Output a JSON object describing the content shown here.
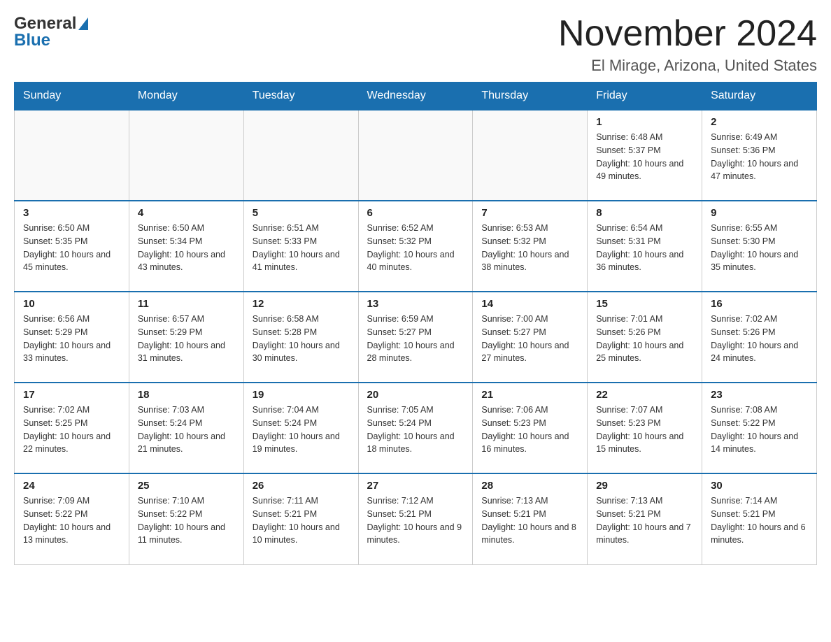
{
  "logo": {
    "line1": "General",
    "line2": "Blue"
  },
  "title": "November 2024",
  "subtitle": "El Mirage, Arizona, United States",
  "days_of_week": [
    "Sunday",
    "Monday",
    "Tuesday",
    "Wednesday",
    "Thursday",
    "Friday",
    "Saturday"
  ],
  "weeks": [
    [
      {
        "day": "",
        "info": ""
      },
      {
        "day": "",
        "info": ""
      },
      {
        "day": "",
        "info": ""
      },
      {
        "day": "",
        "info": ""
      },
      {
        "day": "",
        "info": ""
      },
      {
        "day": "1",
        "info": "Sunrise: 6:48 AM\nSunset: 5:37 PM\nDaylight: 10 hours and 49 minutes."
      },
      {
        "day": "2",
        "info": "Sunrise: 6:49 AM\nSunset: 5:36 PM\nDaylight: 10 hours and 47 minutes."
      }
    ],
    [
      {
        "day": "3",
        "info": "Sunrise: 6:50 AM\nSunset: 5:35 PM\nDaylight: 10 hours and 45 minutes."
      },
      {
        "day": "4",
        "info": "Sunrise: 6:50 AM\nSunset: 5:34 PM\nDaylight: 10 hours and 43 minutes."
      },
      {
        "day": "5",
        "info": "Sunrise: 6:51 AM\nSunset: 5:33 PM\nDaylight: 10 hours and 41 minutes."
      },
      {
        "day": "6",
        "info": "Sunrise: 6:52 AM\nSunset: 5:32 PM\nDaylight: 10 hours and 40 minutes."
      },
      {
        "day": "7",
        "info": "Sunrise: 6:53 AM\nSunset: 5:32 PM\nDaylight: 10 hours and 38 minutes."
      },
      {
        "day": "8",
        "info": "Sunrise: 6:54 AM\nSunset: 5:31 PM\nDaylight: 10 hours and 36 minutes."
      },
      {
        "day": "9",
        "info": "Sunrise: 6:55 AM\nSunset: 5:30 PM\nDaylight: 10 hours and 35 minutes."
      }
    ],
    [
      {
        "day": "10",
        "info": "Sunrise: 6:56 AM\nSunset: 5:29 PM\nDaylight: 10 hours and 33 minutes."
      },
      {
        "day": "11",
        "info": "Sunrise: 6:57 AM\nSunset: 5:29 PM\nDaylight: 10 hours and 31 minutes."
      },
      {
        "day": "12",
        "info": "Sunrise: 6:58 AM\nSunset: 5:28 PM\nDaylight: 10 hours and 30 minutes."
      },
      {
        "day": "13",
        "info": "Sunrise: 6:59 AM\nSunset: 5:27 PM\nDaylight: 10 hours and 28 minutes."
      },
      {
        "day": "14",
        "info": "Sunrise: 7:00 AM\nSunset: 5:27 PM\nDaylight: 10 hours and 27 minutes."
      },
      {
        "day": "15",
        "info": "Sunrise: 7:01 AM\nSunset: 5:26 PM\nDaylight: 10 hours and 25 minutes."
      },
      {
        "day": "16",
        "info": "Sunrise: 7:02 AM\nSunset: 5:26 PM\nDaylight: 10 hours and 24 minutes."
      }
    ],
    [
      {
        "day": "17",
        "info": "Sunrise: 7:02 AM\nSunset: 5:25 PM\nDaylight: 10 hours and 22 minutes."
      },
      {
        "day": "18",
        "info": "Sunrise: 7:03 AM\nSunset: 5:24 PM\nDaylight: 10 hours and 21 minutes."
      },
      {
        "day": "19",
        "info": "Sunrise: 7:04 AM\nSunset: 5:24 PM\nDaylight: 10 hours and 19 minutes."
      },
      {
        "day": "20",
        "info": "Sunrise: 7:05 AM\nSunset: 5:24 PM\nDaylight: 10 hours and 18 minutes."
      },
      {
        "day": "21",
        "info": "Sunrise: 7:06 AM\nSunset: 5:23 PM\nDaylight: 10 hours and 16 minutes."
      },
      {
        "day": "22",
        "info": "Sunrise: 7:07 AM\nSunset: 5:23 PM\nDaylight: 10 hours and 15 minutes."
      },
      {
        "day": "23",
        "info": "Sunrise: 7:08 AM\nSunset: 5:22 PM\nDaylight: 10 hours and 14 minutes."
      }
    ],
    [
      {
        "day": "24",
        "info": "Sunrise: 7:09 AM\nSunset: 5:22 PM\nDaylight: 10 hours and 13 minutes."
      },
      {
        "day": "25",
        "info": "Sunrise: 7:10 AM\nSunset: 5:22 PM\nDaylight: 10 hours and 11 minutes."
      },
      {
        "day": "26",
        "info": "Sunrise: 7:11 AM\nSunset: 5:21 PM\nDaylight: 10 hours and 10 minutes."
      },
      {
        "day": "27",
        "info": "Sunrise: 7:12 AM\nSunset: 5:21 PM\nDaylight: 10 hours and 9 minutes."
      },
      {
        "day": "28",
        "info": "Sunrise: 7:13 AM\nSunset: 5:21 PM\nDaylight: 10 hours and 8 minutes."
      },
      {
        "day": "29",
        "info": "Sunrise: 7:13 AM\nSunset: 5:21 PM\nDaylight: 10 hours and 7 minutes."
      },
      {
        "day": "30",
        "info": "Sunrise: 7:14 AM\nSunset: 5:21 PM\nDaylight: 10 hours and 6 minutes."
      }
    ]
  ]
}
